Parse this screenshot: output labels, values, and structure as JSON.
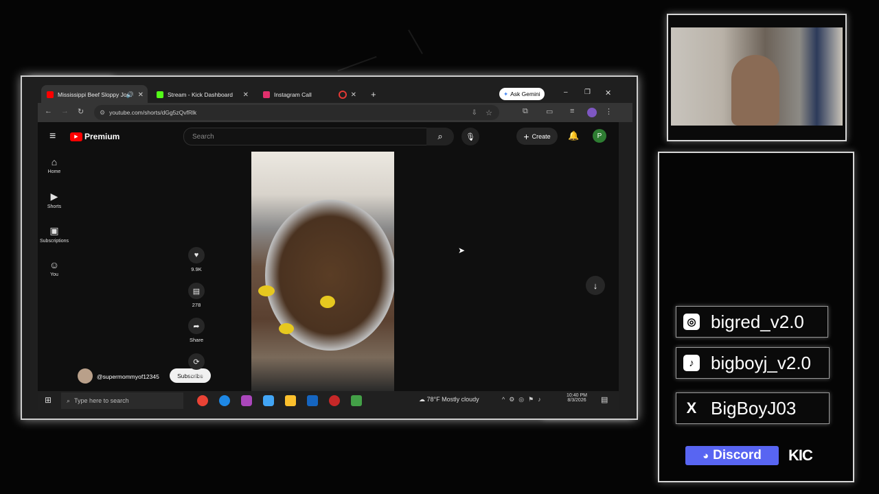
{
  "browser": {
    "tabs": [
      {
        "label": "Mississippi Beef Sloppy Joe",
        "color": "#ff0000",
        "active": true
      },
      {
        "label": "Stream - Kick Dashboard",
        "color": "#53fc18",
        "active": false
      },
      {
        "label": "Instagram Call",
        "color": "#e1306c",
        "active": false
      }
    ],
    "ask_gemini": "Ask Gemini",
    "url": "youtube.com/shorts/dGg5zQvfRlk"
  },
  "youtube": {
    "logo_text": "Premium",
    "search_placeholder": "Search",
    "create_label": "Create",
    "avatar_letter": "P",
    "sidebar": [
      {
        "label": "Home",
        "icon": "home-icon",
        "glyph": "⌂"
      },
      {
        "label": "Shorts",
        "icon": "shorts-icon",
        "glyph": "▶"
      },
      {
        "label": "Subscriptions",
        "icon": "subscriptions-icon",
        "glyph": "▣"
      },
      {
        "label": "You",
        "icon": "you-icon",
        "glyph": "☺"
      }
    ],
    "channel": "@supermommyof12345",
    "subscribe_label": "Subscribe",
    "actions": {
      "likes": "9.9K",
      "comments": "278",
      "share": "Share",
      "remix": "Remix"
    }
  },
  "taskbar": {
    "search_placeholder": "Type here to search",
    "weather": "78°F  Mostly cloudy",
    "time": "10:40 PM",
    "date": "8/3/2026"
  },
  "socials": {
    "instagram": "bigred_v2.0",
    "tiktok": "bigboyj_v2.0",
    "x": "BigBoyJ03",
    "discord": "Discord",
    "kick": "KIC"
  },
  "colors": {
    "youtube_red": "#ff0000",
    "avatar_green": "#2e7d32",
    "discord_blurple": "#5865f2"
  }
}
